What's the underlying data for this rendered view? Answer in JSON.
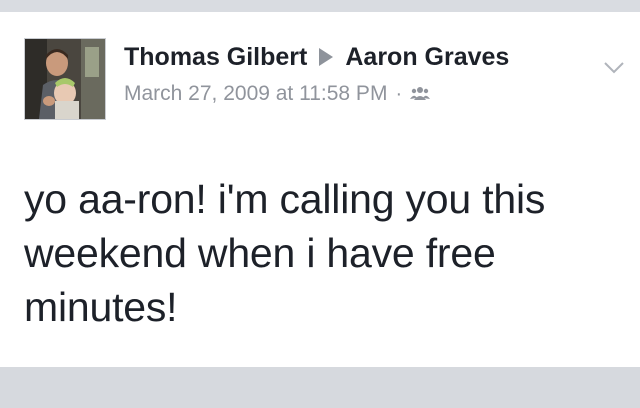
{
  "post": {
    "author": "Thomas Gilbert",
    "recipient": "Aaron Graves",
    "timestamp": "March 27, 2009 at 11:58 PM",
    "separator": "·",
    "audience_icon": "friends-icon",
    "menu_icon": "chevron-down-icon",
    "text": "yo aa-ron! i'm calling you this weekend when i have free minutes!"
  },
  "colors": {
    "page_background": "#dcdfe4",
    "card_background": "#ffffff",
    "name_text": "#1d2129",
    "meta_text": "#90949c"
  }
}
